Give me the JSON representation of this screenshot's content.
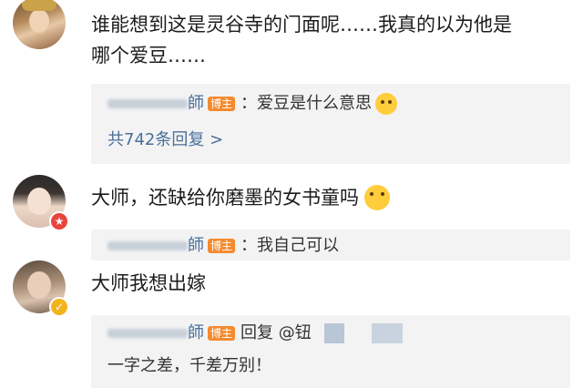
{
  "comments": [
    {
      "text_line1": "谁能想到这是灵谷寺的门面呢……我真的以为他是",
      "text_line2": "哪个爱豆……",
      "reply": {
        "name": "師",
        "tag": "博主",
        "text": "爱豆是什么意思",
        "emoji": "thinking-face-emoji",
        "more": "共742条回复 >"
      }
    },
    {
      "text": "大师，还缺给你磨墨的女书童吗",
      "emoji": "smiling-blush-emoji",
      "reply": {
        "name": "師",
        "tag": "博主",
        "text": "我自己可以"
      }
    },
    {
      "text": "大师我想出嫁",
      "reply": {
        "name": "師",
        "tag": "博主",
        "text": "回复 @钮",
        "text_line2": "一字之差，千差万别！"
      }
    }
  ],
  "colors": {
    "link": "#4a6f9a",
    "tag": "#f58a2f",
    "reply_bg": "#f3f3f3"
  }
}
